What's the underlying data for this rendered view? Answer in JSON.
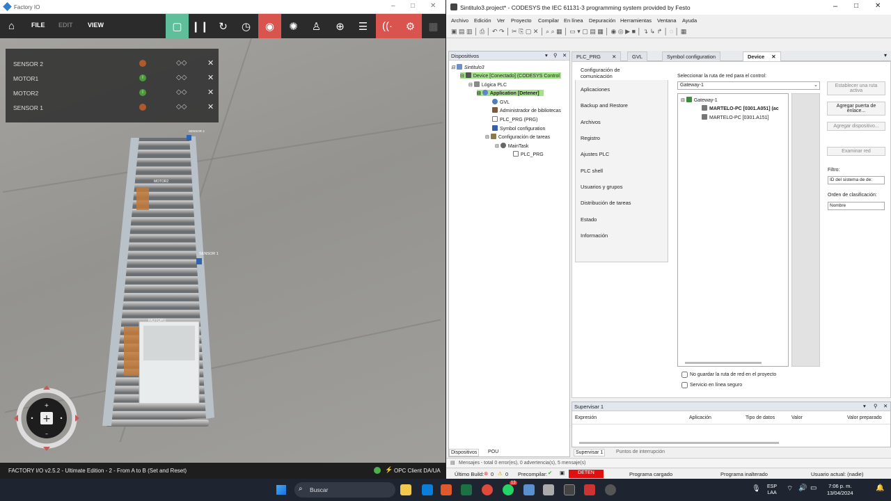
{
  "factoryio": {
    "title": "Factory IO",
    "menu": {
      "file": "FILE",
      "edit": "EDIT",
      "view": "VIEW"
    },
    "sensors": [
      {
        "label": "SENSOR 2",
        "on": false
      },
      {
        "label": "MOTOR1",
        "on": true
      },
      {
        "label": "MOTOR2",
        "on": true
      },
      {
        "label": "SENSOR 1",
        "on": false
      }
    ],
    "scene_labels": {
      "sensor2": "SENSOR 2",
      "motor2": "MOTOR2",
      "sensor1": "SENSOR 1",
      "motor1": "MOTOR1"
    },
    "status_text": "FACTORY I/O v2.5.2 - Ultimate Edition - 2 - From A to B (Set and Reset)",
    "driver": "OPC Client DA/UA"
  },
  "codesys": {
    "title": "Sintitulo3.project* - CODESYS the IEC 61131-3 programming system provided by Festo",
    "menu": [
      "Archivo",
      "Edición",
      "Ver",
      "Proyecto",
      "Compilar",
      "En línea",
      "Depuración",
      "Herramientas",
      "Ventana",
      "Ayuda"
    ],
    "devices_panel_title": "Dispositivos",
    "tree": [
      "Sintitulo3",
      "Device [Conectado] (CODESYS Control",
      "Lógica PLC",
      "Application [Detener]",
      "GVL",
      "Administrador de bibliotecas",
      "PLC_PRG (PRG)",
      "Symbol configuration",
      "Configuración de tareas",
      "MainTask",
      "PLC_PRG"
    ],
    "tabs": [
      "PLC_PRG",
      "GVL",
      "Symbol configuration",
      "Device"
    ],
    "sidebar": [
      "Configuración de comunicación",
      "Aplicaciones",
      "Backup and Restore",
      "Archivos",
      "Registro",
      "Ajustes PLC",
      "PLC shell",
      "Usuarios y grupos",
      "Distribución de tareas",
      "Estado",
      "Información"
    ],
    "network_label": "Seleccionar la ruta de red para el control:",
    "gateway_select": "Gateway-1",
    "net_tree": [
      "Gateway-1",
      "MARTELO-PC [0301.A051] (ac",
      "MARTELO-PC [0301.A151]"
    ],
    "buttons": [
      "Establecer una ruta activa",
      "Agregar puerta de enlace...",
      "Agregar dispositivo...",
      "Examinar red"
    ],
    "filter_label": "Filtro:",
    "filter_value": "ID del sistema de de:",
    "sort_label": "Orden de clasificación:",
    "sort_value": "Nombre",
    "checkbox1": "No guardar la ruta de red en el proyecto",
    "checkbox2": "Servicio en línea seguro",
    "monitor_title": "Supervisar 1",
    "monitor_cols": [
      "Expresión",
      "Aplicación",
      "Tipo de datos",
      "Valor",
      "Valor preparado"
    ],
    "bottom_tabs": [
      "Dispositivos",
      "POU",
      "Supervisar 1",
      "Puntos de interrupción"
    ],
    "messages": "Mensajes - total 0 error(es), 0 advertencia(s), 5 mensaje(s)",
    "status": {
      "last_build": "Último Build:",
      "errors": "0",
      "warnings": "0",
      "precompile": "Precompilar:",
      "run_state": "DETEN",
      "program": "Programa cargado",
      "unchanged": "Programa inalterado",
      "user": "Usuario actual: (nadie)"
    }
  },
  "taskbar": {
    "search": "Buscar",
    "lang1": "ESP",
    "lang2": "LAA",
    "time": "7:06 p. m.",
    "date": "13/04/2024",
    "badge": "13"
  },
  "colors": {
    "accent_green": "#5fbf9a",
    "accent_red": "#d9534f",
    "codesys_green": "#a4e28a"
  }
}
